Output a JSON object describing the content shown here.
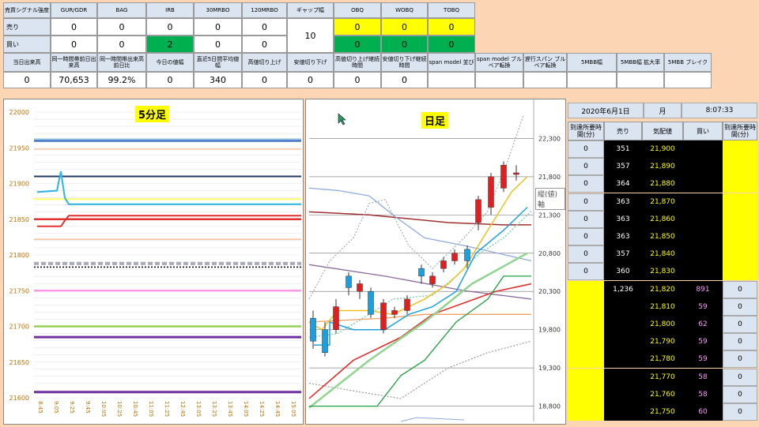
{
  "top": {
    "row_header": "売買シグナル強度",
    "row_sell": "売り",
    "row_buy": "買い",
    "columns": [
      "GUR/GDR",
      "BAG",
      "IRB",
      "30MRBO",
      "120MRBO",
      "ギャップ幅",
      "OBQ",
      "WOBQ",
      "TOBQ"
    ],
    "sell": [
      "0",
      "0",
      "0",
      "0",
      "0",
      "",
      "0",
      "0",
      "0"
    ],
    "buy": [
      "0",
      "0",
      "2",
      "0",
      "0",
      "",
      "0",
      "0",
      "0"
    ],
    "gap_value": "10",
    "row2_headers": [
      "当日出来高",
      "同一時間帯前日出来高",
      "同一時間帯出来高前日比",
      "今日の値幅",
      "直近5日間平均値幅",
      "高値切り上げ",
      "安値切り下げ",
      "高値切り上げ継続時間",
      "安値切り下げ継続時間",
      "span model 並び",
      "span model ブルベア転換",
      "遅行スパン ブルベア転換",
      "5MBB幅",
      "5MBB幅 拡大率",
      "5MBB ブレイク"
    ],
    "row2_values": [
      "0",
      "70,653",
      "99.2%",
      "0",
      "340",
      "0",
      "0",
      "0",
      "0",
      "",
      "",
      "",
      "",
      "",
      ""
    ]
  },
  "chart5": {
    "title": "5分足",
    "yticks": [
      "22000",
      "21950",
      "21900",
      "21850",
      "21800",
      "21750",
      "21700",
      "21650",
      "21600"
    ],
    "xticks": [
      "8:45",
      "9:05",
      "9:25",
      "9:45",
      "10:05",
      "10:25",
      "10:45",
      "11:05",
      "11:25",
      "12:45",
      "13:05",
      "13:25",
      "13:45",
      "14:05",
      "14:25",
      "14:45",
      "15:05"
    ]
  },
  "chartD": {
    "title": "日足",
    "yticks": [
      "22,300",
      "21,800",
      "21,300",
      "20,800",
      "20,300",
      "19,800",
      "19,300",
      "18,800"
    ],
    "tooltip": "縦(値)軸"
  },
  "board": {
    "date": "2020年6月1日",
    "weekday": "月",
    "time": "8:07:33",
    "h_left": "到達所要時間(分)",
    "h_sell": "売り",
    "h_price": "気配値",
    "h_buy": "買い",
    "h_right": "到達所要時間(分)",
    "rows": [
      {
        "l": "0",
        "s": "351",
        "p": "21,900",
        "b": "",
        "r": ""
      },
      {
        "l": "0",
        "s": "357",
        "p": "21,890",
        "b": "",
        "r": ""
      },
      {
        "l": "0",
        "s": "364",
        "p": "21,880",
        "b": "",
        "r": ""
      },
      {
        "l": "0",
        "s": "363",
        "p": "21,870",
        "b": "",
        "r": ""
      },
      {
        "l": "0",
        "s": "363",
        "p": "21,860",
        "b": "",
        "r": ""
      },
      {
        "l": "0",
        "s": "363",
        "p": "21,850",
        "b": "",
        "r": ""
      },
      {
        "l": "0",
        "s": "357",
        "p": "21,840",
        "b": "",
        "r": ""
      },
      {
        "l": "0",
        "s": "360",
        "p": "21,830",
        "b": "",
        "r": ""
      },
      {
        "l": "",
        "s": "1,236",
        "p": "21,820",
        "b": "891",
        "r": "0"
      },
      {
        "l": "",
        "s": "",
        "p": "21,810",
        "b": "59",
        "r": "0"
      },
      {
        "l": "",
        "s": "",
        "p": "21,800",
        "b": "62",
        "r": "0"
      },
      {
        "l": "",
        "s": "",
        "p": "21,790",
        "b": "59",
        "r": "0"
      },
      {
        "l": "",
        "s": "",
        "p": "21,780",
        "b": "59",
        "r": "0"
      },
      {
        "l": "",
        "s": "",
        "p": "21,770",
        "b": "58",
        "r": "0"
      },
      {
        "l": "",
        "s": "",
        "p": "21,760",
        "b": "58",
        "r": "0"
      },
      {
        "l": "",
        "s": "",
        "p": "21,750",
        "b": "60",
        "r": "0"
      }
    ]
  }
}
